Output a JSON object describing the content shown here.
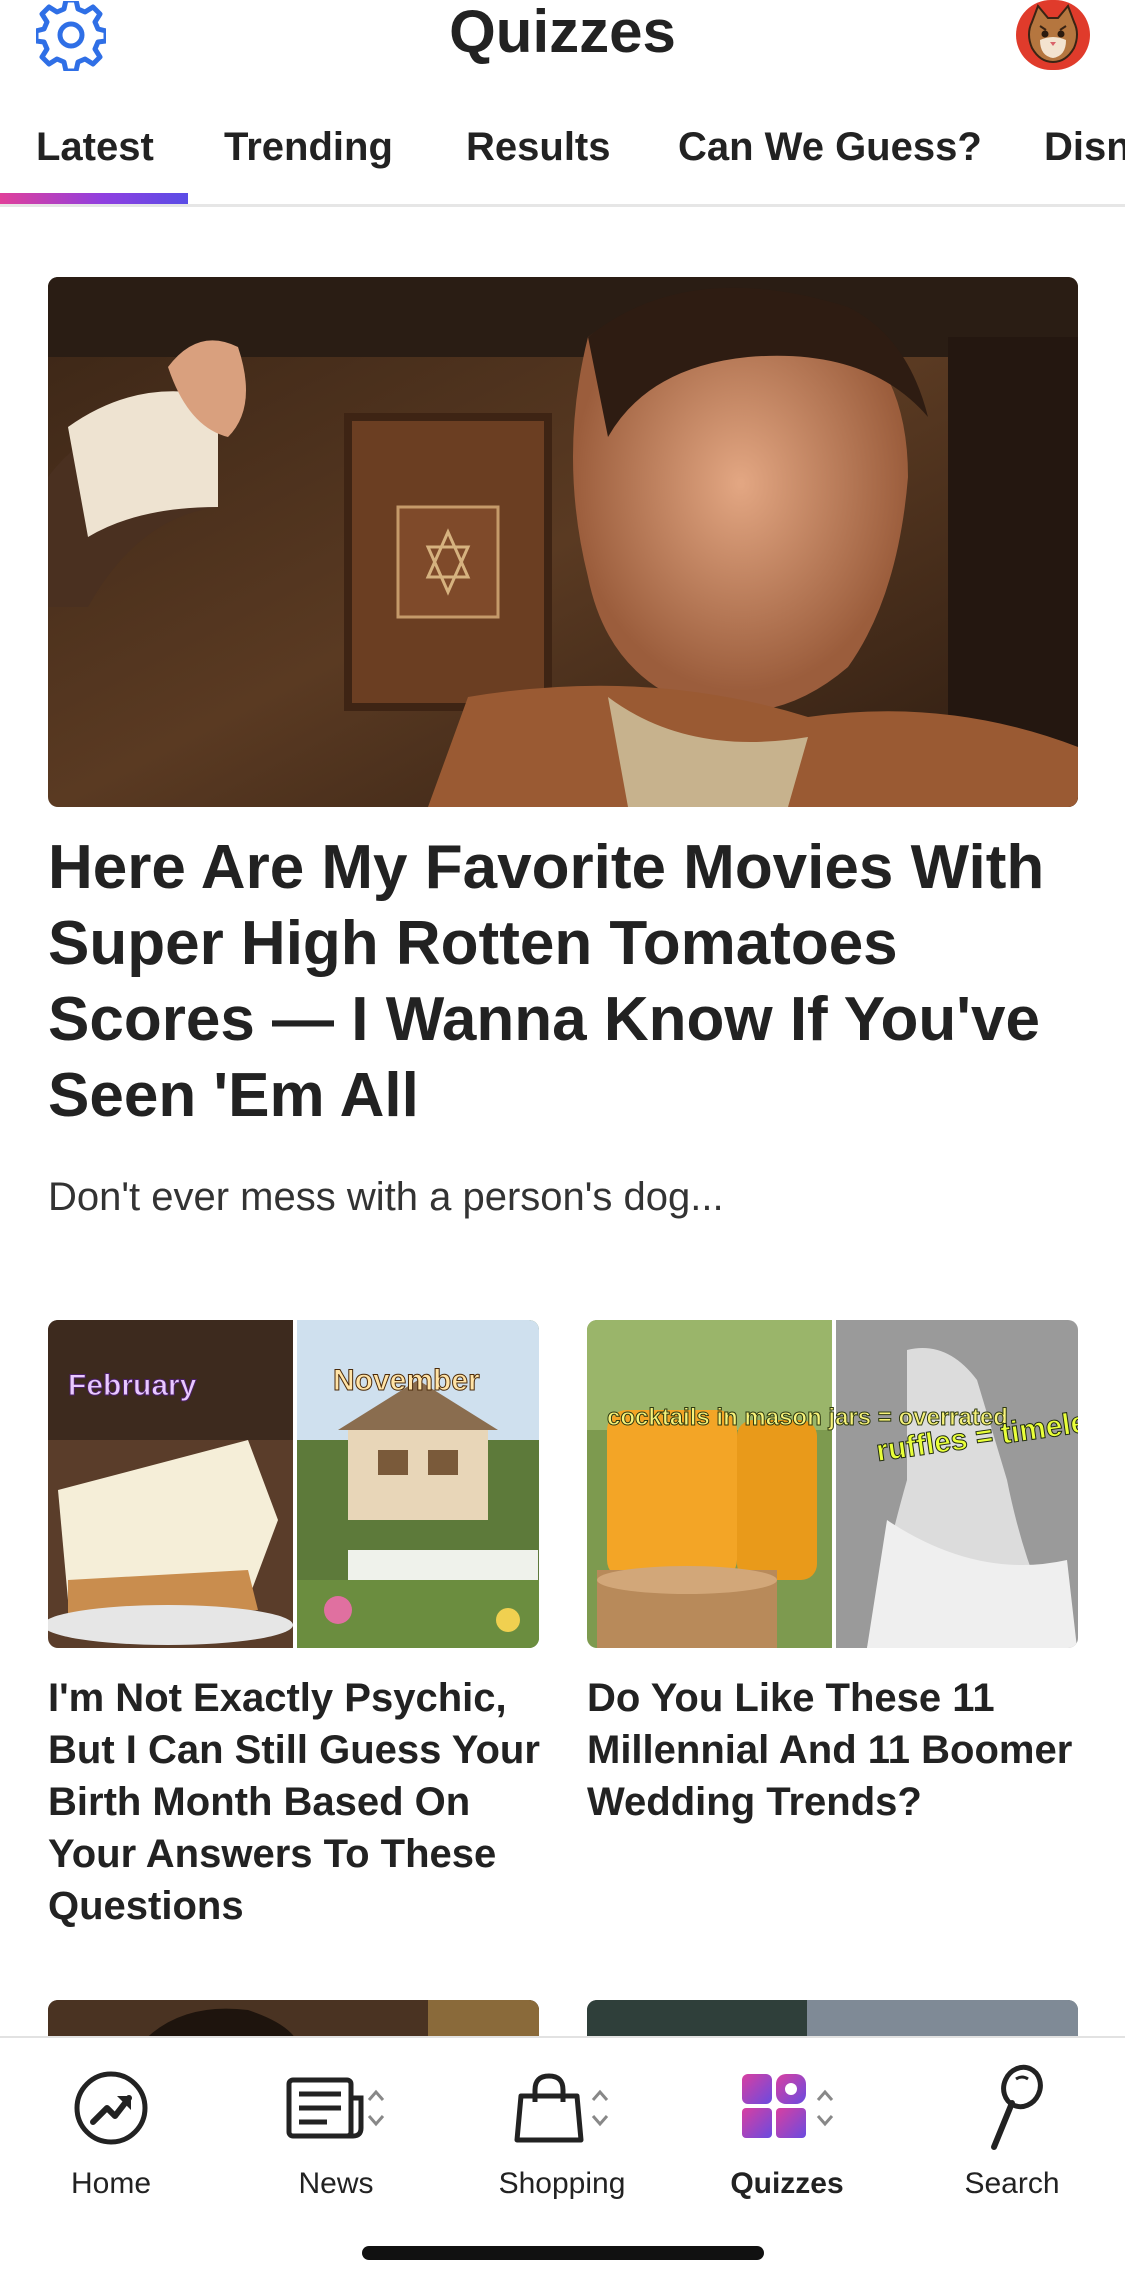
{
  "header": {
    "title": "Quizzes"
  },
  "tabs": [
    {
      "label": "Latest"
    },
    {
      "label": "Trending"
    },
    {
      "label": "Results"
    },
    {
      "label": "Can We Guess?"
    },
    {
      "label": "Disn"
    }
  ],
  "hero": {
    "title": "Here Are My Favorite Movies With Super High Rotten Tomatoes Scores — I Wanna Know If You've Seen 'Em All",
    "description": "Don't ever mess with a person's dog..."
  },
  "cards": [
    {
      "title": "I'm Not Exactly Psychic, But I Can Still Guess Your Birth Month Based On Your Answers To These Questions",
      "image_text": [
        "February",
        "November"
      ]
    },
    {
      "title": "Do You Like These 11 Millennial And 11 Boomer Wedding Trends?",
      "image_text": [
        "cocktails in mason jars = overrated",
        "ruffles = timeless"
      ]
    }
  ],
  "bottom_nav": [
    {
      "label": "Home",
      "icon": "trending-icon"
    },
    {
      "label": "News",
      "icon": "news-icon"
    },
    {
      "label": "Shopping",
      "icon": "shopping-bag-icon"
    },
    {
      "label": "Quizzes",
      "icon": "quizzes-icon",
      "active": true
    },
    {
      "label": "Search",
      "icon": "search-icon"
    }
  ],
  "colors": {
    "accent_blue": "#2f6fe6",
    "tab_gradient": [
      "#e0409a",
      "#5a4de6"
    ],
    "avatar_bg": "#e03b2b",
    "quizzes_icon": [
      "#d93fa0",
      "#6a4be0"
    ]
  }
}
